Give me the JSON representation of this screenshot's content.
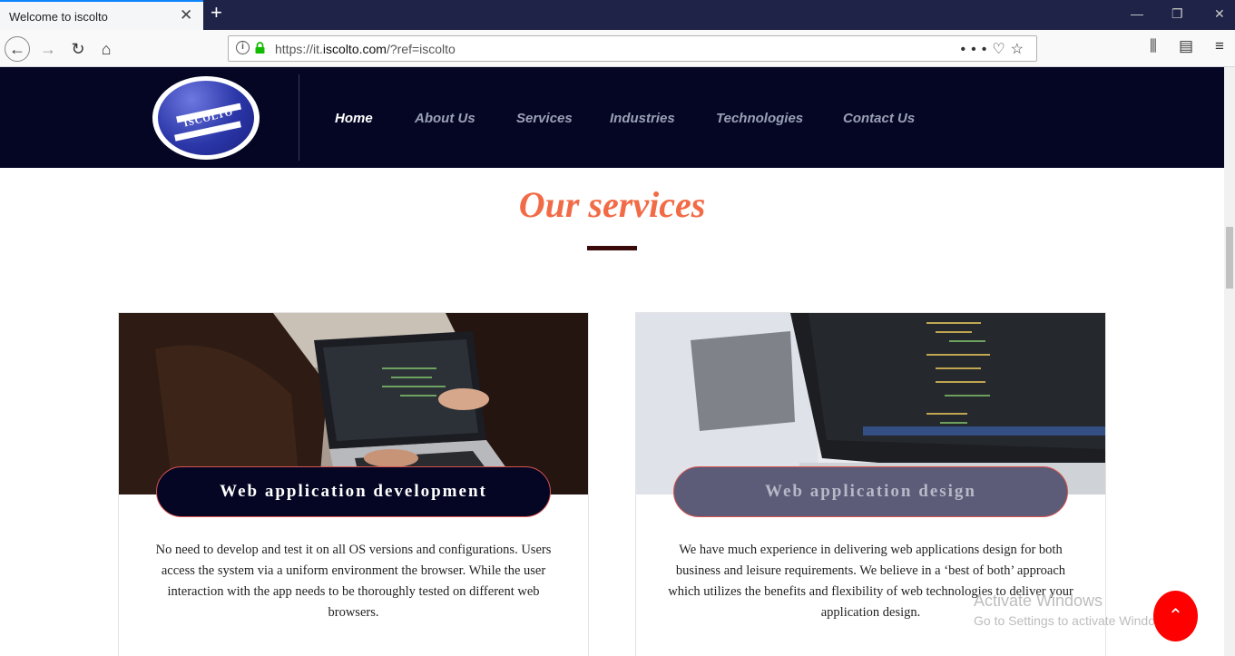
{
  "browser": {
    "tab_title": "Welcome to iscolto",
    "url_prefix": "https://it.",
    "url_host": "iscolto.com",
    "url_suffix": "/?ref=iscolto"
  },
  "site": {
    "logo_text": "ISCOLTO",
    "nav": [
      "Home",
      "About Us",
      "Services",
      "Industries",
      "Technologies",
      "Contact Us"
    ],
    "active_nav": "Home"
  },
  "services": {
    "heading": "Our services",
    "cards": [
      {
        "title": "Web application development",
        "text": "No need to develop and test it on all OS versions and configurations. Users access the system via a uniform environment the browser. While the user interaction with the app needs to be thoroughly tested on different web browsers."
      },
      {
        "title": "Web application design",
        "text": "We have much experience in delivering web applications design for both business and leisure requirements. We believe in a ‘best of both’ approach which utilizes the benefits and flexibility of web technologies to deliver your application design."
      }
    ]
  },
  "watermark": {
    "line1": "Activate Windows",
    "line2": "Go to Settings to activate Windows."
  },
  "colors": {
    "header_bg": "#050624",
    "heading": "#f26b47",
    "scroll_top_button": "#ff0000"
  }
}
